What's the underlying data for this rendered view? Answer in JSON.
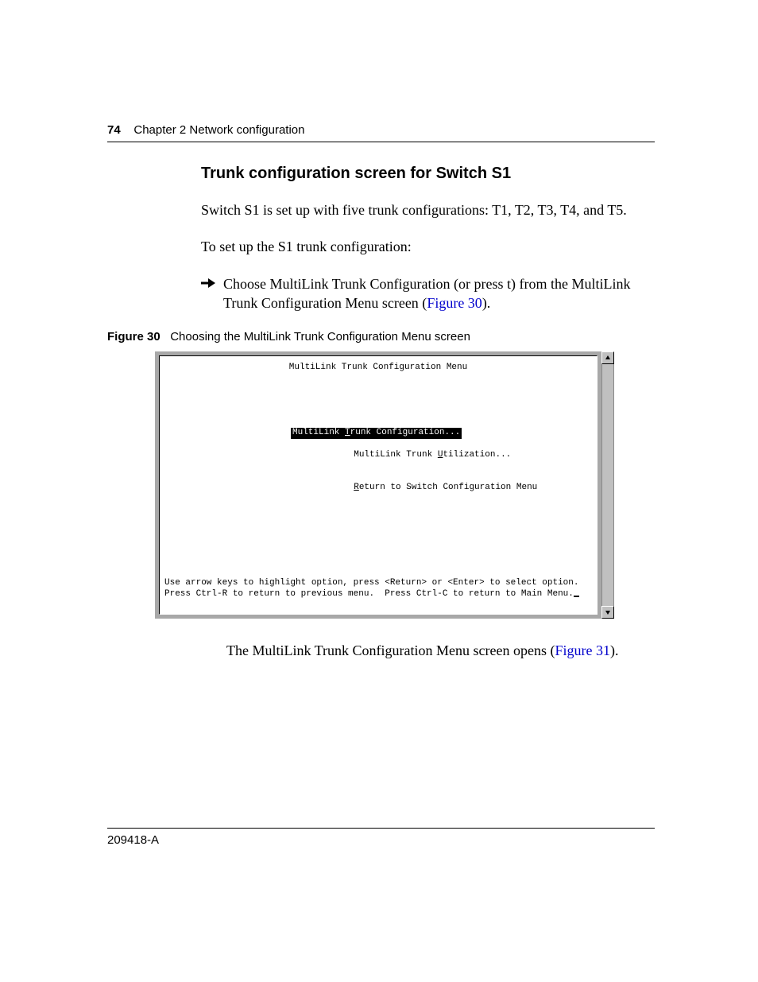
{
  "header": {
    "page_number": "74",
    "chapter_label": "Chapter 2  Network configuration"
  },
  "section_title": "Trunk configuration screen for Switch S1",
  "para1": "Switch S1 is set up with five trunk configurations: T1, T2, T3, T4, and T5.",
  "para2": "To set up the S1 trunk configuration:",
  "bullet": {
    "text_before_link": "Choose MultiLink Trunk Configuration (or press t) from the MultiLink Trunk Configuration Menu screen (",
    "link_text": "Figure 30",
    "text_after_link": ")."
  },
  "figure_caption": {
    "label": "Figure 30",
    "text": "Choosing the MultiLink Trunk Configuration Menu screen"
  },
  "terminal": {
    "title": "MultiLink Trunk Configuration Menu",
    "menu_items": [
      {
        "hotkey": "T",
        "rest": "runk Configuration...",
        "prefix": "MultiLink ",
        "selected": true
      },
      {
        "hotkey": "U",
        "rest": "tilization...",
        "prefix": "MultiLink Trunk ",
        "selected": false
      },
      {
        "hotkey": "R",
        "rest": "eturn to Switch Configuration Menu",
        "prefix": "",
        "selected": false
      }
    ],
    "footer_line1": "Use arrow keys to highlight option, press <Return> or <Enter> to select option.",
    "footer_line2": "Press Ctrl-R to return to previous menu.  Press Ctrl-C to return to Main Menu."
  },
  "after_fig": {
    "before": "The MultiLink Trunk Configuration Menu screen opens (",
    "link": "Figure 31",
    "after": ")."
  },
  "footer_doc_id": "209418-A"
}
